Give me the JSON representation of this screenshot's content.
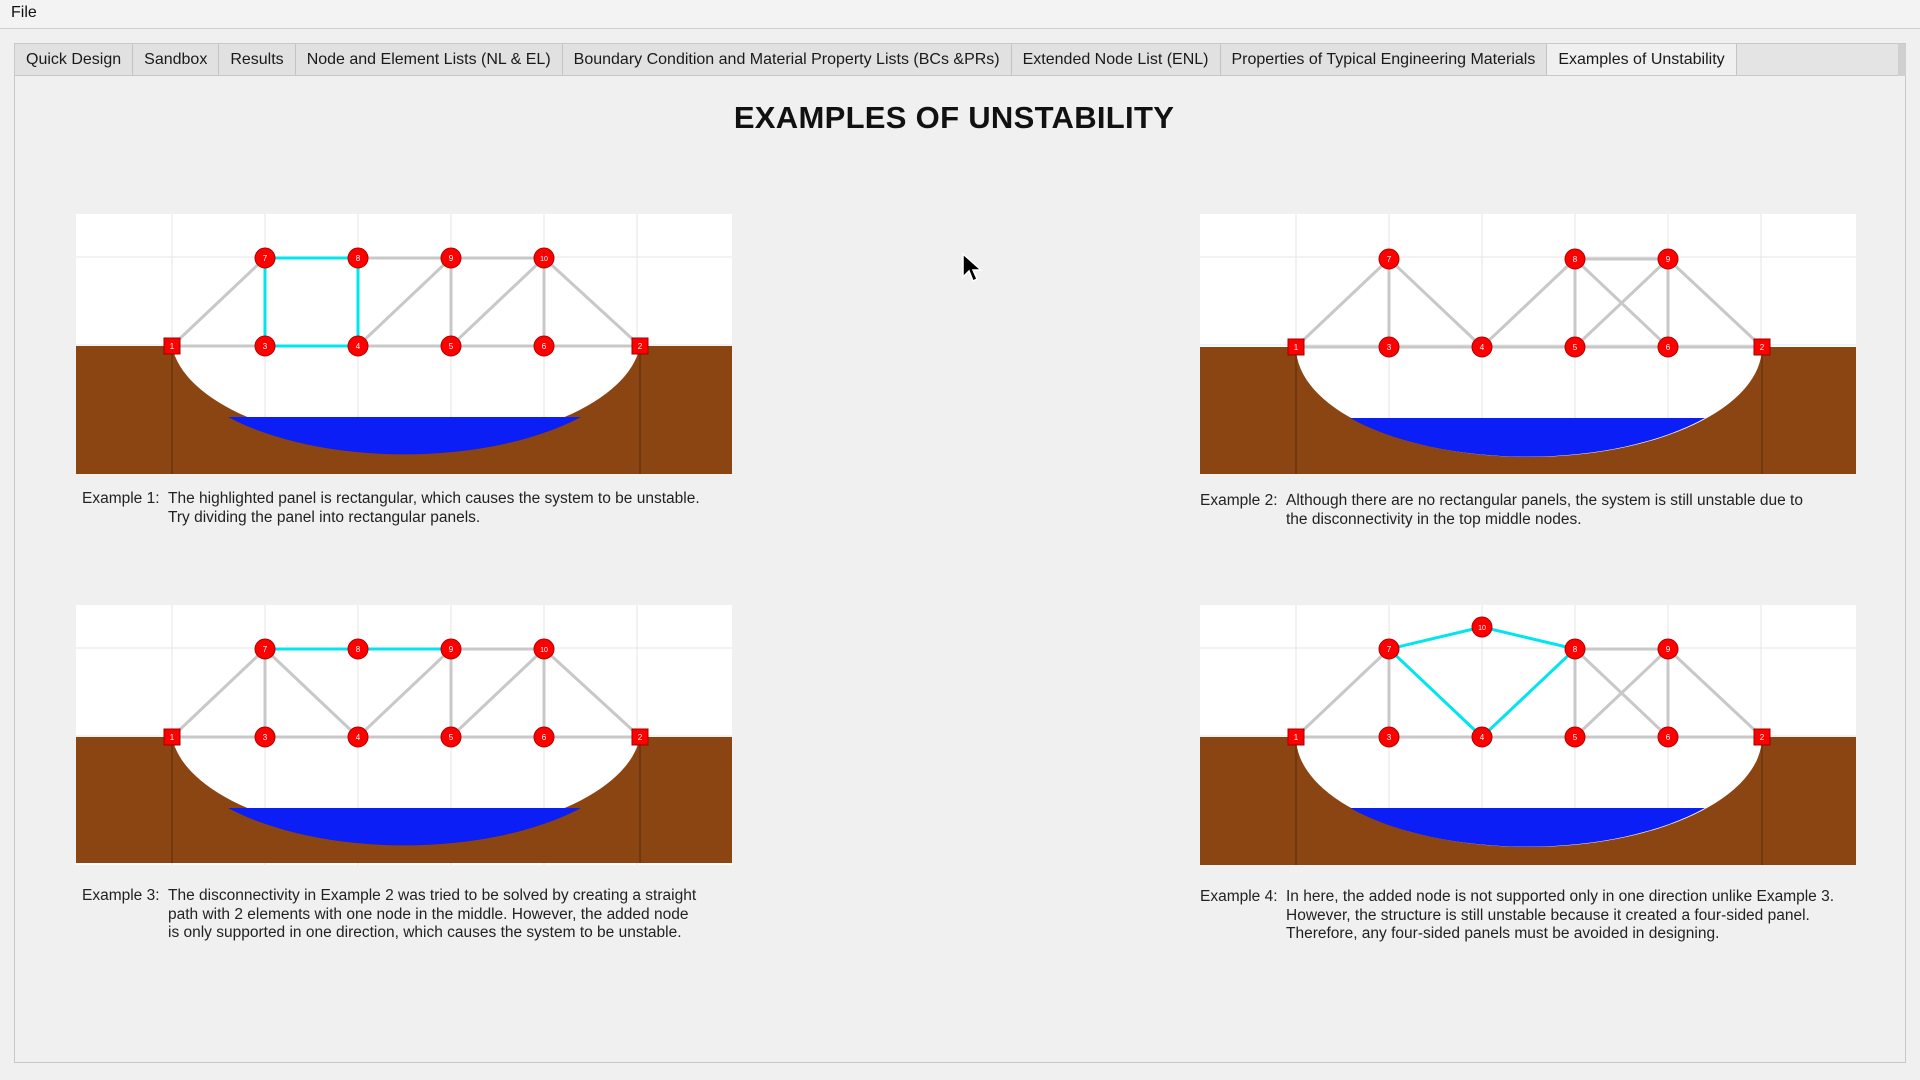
{
  "menu": {
    "file": "File"
  },
  "tabs": [
    {
      "label": "Quick Design",
      "active": false
    },
    {
      "label": "Sandbox",
      "active": false
    },
    {
      "label": "Results",
      "active": false
    },
    {
      "label": "Node and Element Lists (NL & EL)",
      "active": false
    },
    {
      "label": "Boundary Condition and Material Property Lists (BCs &PRs)",
      "active": false
    },
    {
      "label": "Extended Node List (ENL)",
      "active": false
    },
    {
      "label": "Properties of Typical Engineering Materials",
      "active": false
    },
    {
      "label": "Examples of Unstability",
      "active": true
    }
  ],
  "page": {
    "title": "EXAMPLES OF UNSTABILITY"
  },
  "colors": {
    "soil": "#8b4513",
    "water": "#0a1ef5",
    "node": "#ff0000",
    "member": "#c8c8c8",
    "highlight": "#00e5ee",
    "grid": "#e6e6e6"
  },
  "examples": [
    {
      "label": "Example 1:",
      "text": "The highlighted panel is rectangular, which causes the system to be unstable. Try dividing the panel into rectangular panels.",
      "text_lines": [
        "The highlighted panel is rectangular, which causes the system to be unstable.",
        "Try dividing the panel into rectangular panels."
      ],
      "support_labels": [
        "1",
        "2"
      ],
      "node_labels": [
        "3",
        "4",
        "5",
        "6",
        "7",
        "8",
        "9",
        "10"
      ]
    },
    {
      "label": "Example 2:",
      "text": "Although there are no rectangular panels, the system is still unstable due to the disconnectivity in the top middle nodes.",
      "text_lines": [
        "Although there are no rectangular panels, the system is still unstable due to",
        "the disconnectivity in the top middle nodes."
      ],
      "support_labels": [
        "1",
        "2"
      ],
      "node_labels": [
        "3",
        "4",
        "5",
        "6",
        "7",
        "8",
        "9"
      ]
    },
    {
      "label": "Example 3:",
      "text": "The disconnectivity in Example 2 was tried to be solved by creating a straight path with 2 elements with one node in the middle. However, the added node is only supported in one direction, which causes the system to be unstable.",
      "text_lines": [
        "The disconnectivity in Example 2 was tried to be solved by creating a straight",
        "path with 2 elements with one node in the middle. However, the added node",
        "is only supported in one direction, which causes the system to be unstable."
      ],
      "support_labels": [
        "1",
        "2"
      ],
      "node_labels": [
        "3",
        "4",
        "5",
        "6",
        "7",
        "8",
        "9",
        "10"
      ]
    },
    {
      "label": "Example 4:",
      "text": "In here, the added node is not supported only in one direction unlike Example 3. However, the structure is still unstable because it created a four-sided panel. Therefore, any four-sided panels must be avoided in designing.",
      "text_lines": [
        "In here, the added node is not supported only in one direction unlike Example 3.",
        "However, the structure is still unstable because it created a four-sided panel.",
        "Therefore, any four-sided panels must be avoided in designing."
      ],
      "support_labels": [
        "1",
        "2"
      ],
      "node_labels": [
        "3",
        "4",
        "5",
        "6",
        "7",
        "8",
        "9",
        "10"
      ]
    }
  ]
}
